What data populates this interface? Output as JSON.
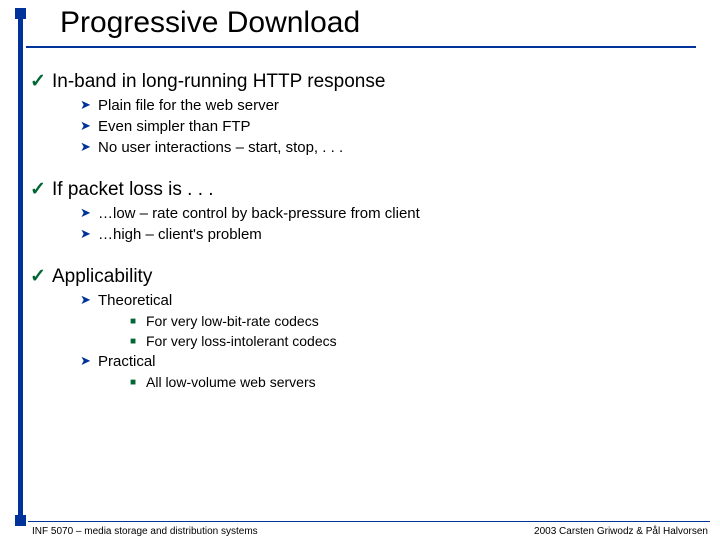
{
  "title": "Progressive Download",
  "sec1": {
    "head": "In-band in long-running HTTP response",
    "b1": "Plain file for the web server",
    "b2": "Even simpler than FTP",
    "b3": "No user interactions – start, stop, . . ."
  },
  "sec2": {
    "head": "If packet loss is . . .",
    "b1": "…low – rate control by back-pressure from client",
    "b2": "…high – client's problem"
  },
  "sec3": {
    "head": "Applicability",
    "s1": "Theoretical",
    "s1b1": "For very low-bit-rate codecs",
    "s1b2": "For very loss-intolerant codecs",
    "s2": "Practical",
    "s2b1": "All low-volume web servers"
  },
  "footer": {
    "left": "INF 5070 – media storage and distribution systems",
    "right": "2003  Carsten Griwodz & Pål Halvorsen"
  }
}
